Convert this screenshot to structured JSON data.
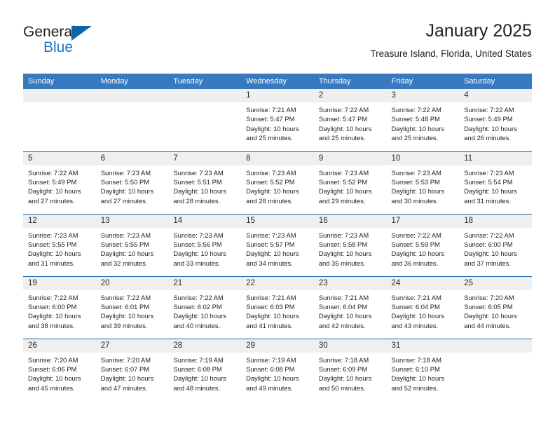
{
  "logo": {
    "word1": "General",
    "word2": "Blue",
    "triangle_color": "#0f64a8",
    "blue_text_color": "#1878c8"
  },
  "header": {
    "title": "January 2025",
    "subtitle": "Treasure Island, Florida, United States",
    "header_bg_color": "#3879bf",
    "row_rule_color": "#1a69b0",
    "daynum_bg_color": "#efefef"
  },
  "weekday_headers": [
    "Sunday",
    "Monday",
    "Tuesday",
    "Wednesday",
    "Thursday",
    "Friday",
    "Saturday"
  ],
  "weeks": [
    [
      {
        "day": "",
        "sunrise": "",
        "sunset": "",
        "daylight_l1": "",
        "daylight_l2": ""
      },
      {
        "day": "",
        "sunrise": "",
        "sunset": "",
        "daylight_l1": "",
        "daylight_l2": ""
      },
      {
        "day": "",
        "sunrise": "",
        "sunset": "",
        "daylight_l1": "",
        "daylight_l2": ""
      },
      {
        "day": "1",
        "sunrise": "Sunrise: 7:21 AM",
        "sunset": "Sunset: 5:47 PM",
        "daylight_l1": "Daylight: 10 hours",
        "daylight_l2": "and 25 minutes."
      },
      {
        "day": "2",
        "sunrise": "Sunrise: 7:22 AM",
        "sunset": "Sunset: 5:47 PM",
        "daylight_l1": "Daylight: 10 hours",
        "daylight_l2": "and 25 minutes."
      },
      {
        "day": "3",
        "sunrise": "Sunrise: 7:22 AM",
        "sunset": "Sunset: 5:48 PM",
        "daylight_l1": "Daylight: 10 hours",
        "daylight_l2": "and 25 minutes."
      },
      {
        "day": "4",
        "sunrise": "Sunrise: 7:22 AM",
        "sunset": "Sunset: 5:49 PM",
        "daylight_l1": "Daylight: 10 hours",
        "daylight_l2": "and 26 minutes."
      }
    ],
    [
      {
        "day": "5",
        "sunrise": "Sunrise: 7:22 AM",
        "sunset": "Sunset: 5:49 PM",
        "daylight_l1": "Daylight: 10 hours",
        "daylight_l2": "and 27 minutes."
      },
      {
        "day": "6",
        "sunrise": "Sunrise: 7:23 AM",
        "sunset": "Sunset: 5:50 PM",
        "daylight_l1": "Daylight: 10 hours",
        "daylight_l2": "and 27 minutes."
      },
      {
        "day": "7",
        "sunrise": "Sunrise: 7:23 AM",
        "sunset": "Sunset: 5:51 PM",
        "daylight_l1": "Daylight: 10 hours",
        "daylight_l2": "and 28 minutes."
      },
      {
        "day": "8",
        "sunrise": "Sunrise: 7:23 AM",
        "sunset": "Sunset: 5:52 PM",
        "daylight_l1": "Daylight: 10 hours",
        "daylight_l2": "and 28 minutes."
      },
      {
        "day": "9",
        "sunrise": "Sunrise: 7:23 AM",
        "sunset": "Sunset: 5:52 PM",
        "daylight_l1": "Daylight: 10 hours",
        "daylight_l2": "and 29 minutes."
      },
      {
        "day": "10",
        "sunrise": "Sunrise: 7:23 AM",
        "sunset": "Sunset: 5:53 PM",
        "daylight_l1": "Daylight: 10 hours",
        "daylight_l2": "and 30 minutes."
      },
      {
        "day": "11",
        "sunrise": "Sunrise: 7:23 AM",
        "sunset": "Sunset: 5:54 PM",
        "daylight_l1": "Daylight: 10 hours",
        "daylight_l2": "and 31 minutes."
      }
    ],
    [
      {
        "day": "12",
        "sunrise": "Sunrise: 7:23 AM",
        "sunset": "Sunset: 5:55 PM",
        "daylight_l1": "Daylight: 10 hours",
        "daylight_l2": "and 31 minutes."
      },
      {
        "day": "13",
        "sunrise": "Sunrise: 7:23 AM",
        "sunset": "Sunset: 5:55 PM",
        "daylight_l1": "Daylight: 10 hours",
        "daylight_l2": "and 32 minutes."
      },
      {
        "day": "14",
        "sunrise": "Sunrise: 7:23 AM",
        "sunset": "Sunset: 5:56 PM",
        "daylight_l1": "Daylight: 10 hours",
        "daylight_l2": "and 33 minutes."
      },
      {
        "day": "15",
        "sunrise": "Sunrise: 7:23 AM",
        "sunset": "Sunset: 5:57 PM",
        "daylight_l1": "Daylight: 10 hours",
        "daylight_l2": "and 34 minutes."
      },
      {
        "day": "16",
        "sunrise": "Sunrise: 7:23 AM",
        "sunset": "Sunset: 5:58 PM",
        "daylight_l1": "Daylight: 10 hours",
        "daylight_l2": "and 35 minutes."
      },
      {
        "day": "17",
        "sunrise": "Sunrise: 7:22 AM",
        "sunset": "Sunset: 5:59 PM",
        "daylight_l1": "Daylight: 10 hours",
        "daylight_l2": "and 36 minutes."
      },
      {
        "day": "18",
        "sunrise": "Sunrise: 7:22 AM",
        "sunset": "Sunset: 6:00 PM",
        "daylight_l1": "Daylight: 10 hours",
        "daylight_l2": "and 37 minutes."
      }
    ],
    [
      {
        "day": "19",
        "sunrise": "Sunrise: 7:22 AM",
        "sunset": "Sunset: 6:00 PM",
        "daylight_l1": "Daylight: 10 hours",
        "daylight_l2": "and 38 minutes."
      },
      {
        "day": "20",
        "sunrise": "Sunrise: 7:22 AM",
        "sunset": "Sunset: 6:01 PM",
        "daylight_l1": "Daylight: 10 hours",
        "daylight_l2": "and 39 minutes."
      },
      {
        "day": "21",
        "sunrise": "Sunrise: 7:22 AM",
        "sunset": "Sunset: 6:02 PM",
        "daylight_l1": "Daylight: 10 hours",
        "daylight_l2": "and 40 minutes."
      },
      {
        "day": "22",
        "sunrise": "Sunrise: 7:21 AM",
        "sunset": "Sunset: 6:03 PM",
        "daylight_l1": "Daylight: 10 hours",
        "daylight_l2": "and 41 minutes."
      },
      {
        "day": "23",
        "sunrise": "Sunrise: 7:21 AM",
        "sunset": "Sunset: 6:04 PM",
        "daylight_l1": "Daylight: 10 hours",
        "daylight_l2": "and 42 minutes."
      },
      {
        "day": "24",
        "sunrise": "Sunrise: 7:21 AM",
        "sunset": "Sunset: 6:04 PM",
        "daylight_l1": "Daylight: 10 hours",
        "daylight_l2": "and 43 minutes."
      },
      {
        "day": "25",
        "sunrise": "Sunrise: 7:20 AM",
        "sunset": "Sunset: 6:05 PM",
        "daylight_l1": "Daylight: 10 hours",
        "daylight_l2": "and 44 minutes."
      }
    ],
    [
      {
        "day": "26",
        "sunrise": "Sunrise: 7:20 AM",
        "sunset": "Sunset: 6:06 PM",
        "daylight_l1": "Daylight: 10 hours",
        "daylight_l2": "and 45 minutes."
      },
      {
        "day": "27",
        "sunrise": "Sunrise: 7:20 AM",
        "sunset": "Sunset: 6:07 PM",
        "daylight_l1": "Daylight: 10 hours",
        "daylight_l2": "and 47 minutes."
      },
      {
        "day": "28",
        "sunrise": "Sunrise: 7:19 AM",
        "sunset": "Sunset: 6:08 PM",
        "daylight_l1": "Daylight: 10 hours",
        "daylight_l2": "and 48 minutes."
      },
      {
        "day": "29",
        "sunrise": "Sunrise: 7:19 AM",
        "sunset": "Sunset: 6:08 PM",
        "daylight_l1": "Daylight: 10 hours",
        "daylight_l2": "and 49 minutes."
      },
      {
        "day": "30",
        "sunrise": "Sunrise: 7:18 AM",
        "sunset": "Sunset: 6:09 PM",
        "daylight_l1": "Daylight: 10 hours",
        "daylight_l2": "and 50 minutes."
      },
      {
        "day": "31",
        "sunrise": "Sunrise: 7:18 AM",
        "sunset": "Sunset: 6:10 PM",
        "daylight_l1": "Daylight: 10 hours",
        "daylight_l2": "and 52 minutes."
      },
      {
        "day": "",
        "sunrise": "",
        "sunset": "",
        "daylight_l1": "",
        "daylight_l2": ""
      }
    ]
  ]
}
